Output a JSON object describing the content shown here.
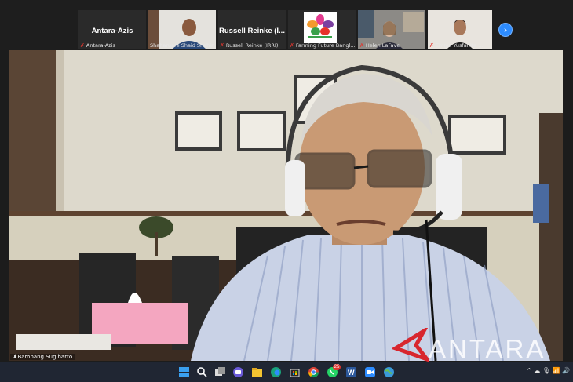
{
  "participants": [
    {
      "display": "Antara-Azis",
      "caption": "Antara-Azis",
      "video": false
    },
    {
      "display": "",
      "caption": "Shaharuare Shaid Shahin",
      "video": true
    },
    {
      "display": "Russell Reinke (I...",
      "caption": "Russell Reinke (IRRI)",
      "video": false
    },
    {
      "display": "",
      "caption": "Farming Future Bangl...",
      "video": true
    },
    {
      "display": "",
      "caption": "Helen LaFave",
      "video": true
    },
    {
      "display": "",
      "caption": "Emma Yusfanita ...",
      "video": true
    }
  ],
  "main_speaker": {
    "name": "Bambang Sugiharto"
  },
  "watermark": {
    "text": "ANTARA"
  },
  "taskbar": {
    "icons": [
      "windows-start-icon",
      "search-icon",
      "task-view-icon",
      "teams-chat-icon",
      "file-explorer-icon",
      "edge-browser-icon",
      "store-icon",
      "chrome-icon",
      "whatsapp-icon",
      "word-icon",
      "zoom-icon",
      "globe-icon"
    ],
    "whatsapp_badge": "25",
    "tray_text": "^  ☁  🎙  📶 🔊"
  },
  "colors": {
    "zoom_blue": "#2d8cff",
    "muted_red": "#e0362f",
    "taskbar": "#202633",
    "watermark_red": "#d8262e"
  }
}
